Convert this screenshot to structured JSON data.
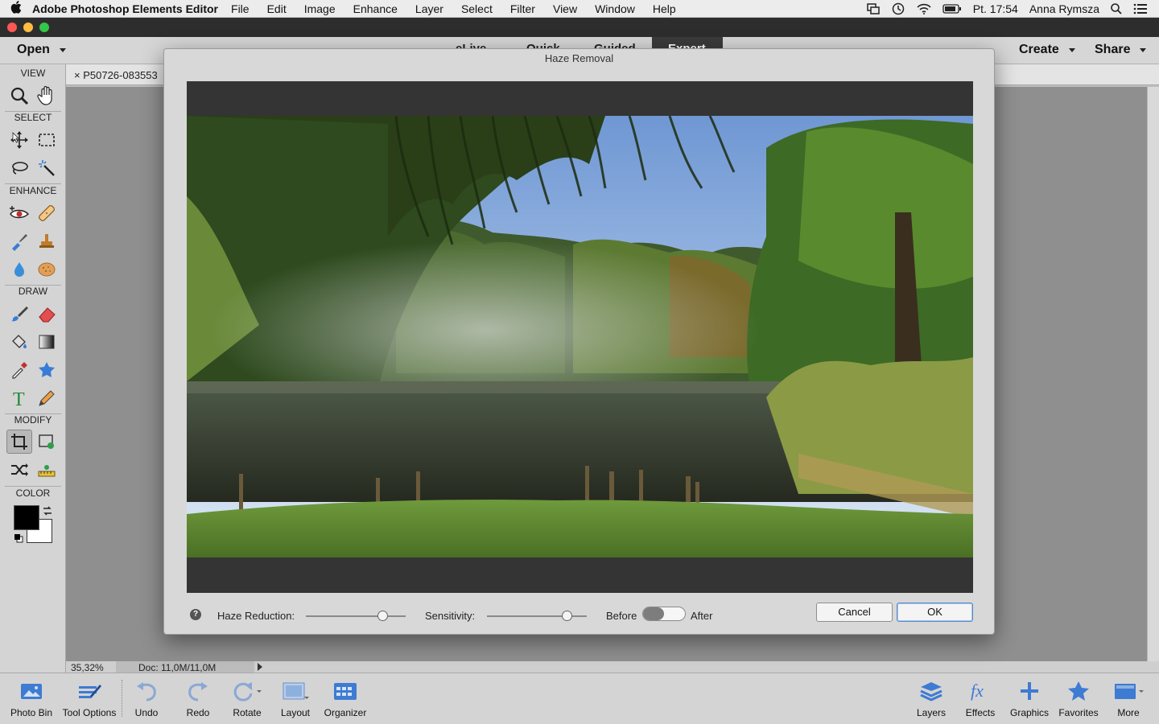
{
  "menubar": {
    "app_name": "Adobe Photoshop Elements Editor",
    "menus": [
      "File",
      "Edit",
      "Image",
      "Enhance",
      "Layer",
      "Select",
      "Filter",
      "View",
      "Window",
      "Help"
    ],
    "clock": "Pt. 17:54",
    "user": "Anna Rymsza"
  },
  "header": {
    "open_label": "Open",
    "modes": [
      "eLive",
      "Quick",
      "Guided",
      "Expert"
    ],
    "active_mode": "Expert",
    "create_label": "Create",
    "share_label": "Share"
  },
  "toolbar": {
    "sections": {
      "view": "VIEW",
      "select": "SELECT",
      "enhance": "ENHANCE",
      "draw": "DRAW",
      "modify": "MODIFY",
      "color": "COLOR"
    }
  },
  "document": {
    "tab_title": "P50726-083553",
    "zoom": "35,32%",
    "doc_size": "Doc: 11,0M/11,0M"
  },
  "dialog": {
    "title": "Haze Removal",
    "haze_reduction_label": "Haze Reduction:",
    "haze_reduction_value": 0.77,
    "sensitivity_label": "Sensitivity:",
    "sensitivity_value": 0.8,
    "before_label": "Before",
    "after_label": "After",
    "help_glyph": "?",
    "cancel_label": "Cancel",
    "ok_label": "OK"
  },
  "taskbar": {
    "left": [
      "Photo Bin",
      "Tool Options",
      "Undo",
      "Redo",
      "Rotate",
      "Layout",
      "Organizer"
    ],
    "right": [
      "Layers",
      "Effects",
      "Graphics",
      "Favorites",
      "More"
    ]
  },
  "colors": {
    "accent_blue": "#3e7bd3",
    "dialog_bg": "#d8d8d8",
    "active_tab_bg": "#3b3b3b"
  }
}
